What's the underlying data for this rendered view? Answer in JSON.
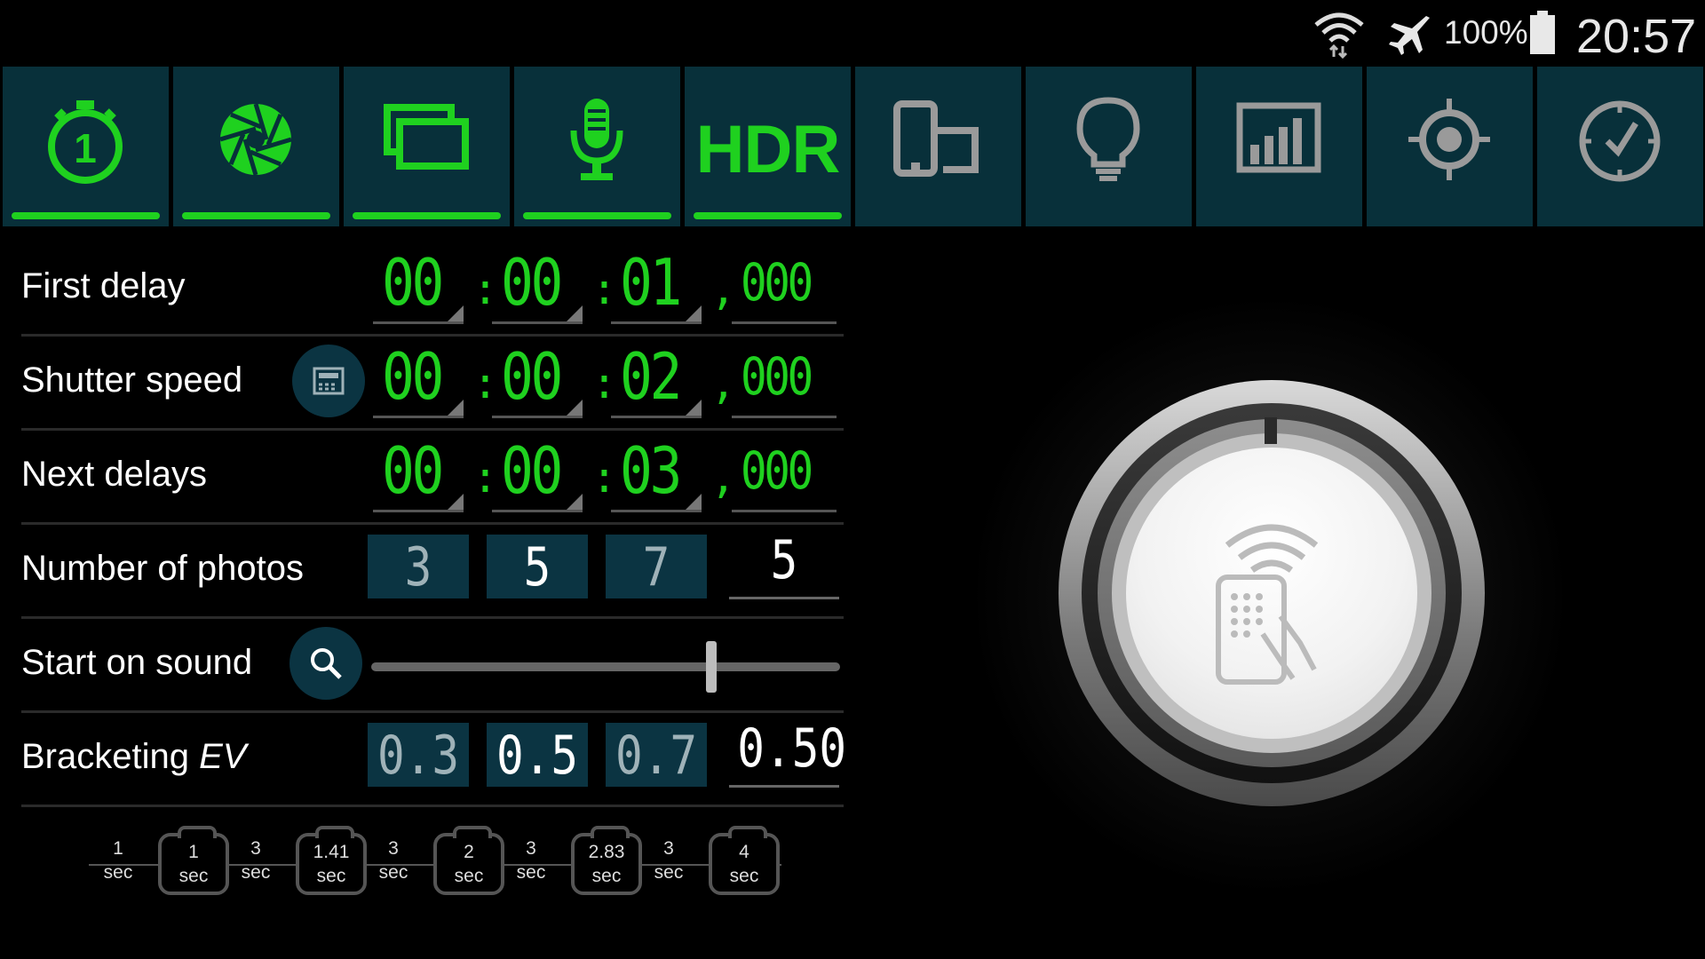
{
  "status_bar": {
    "battery": "100%",
    "time": "20:57"
  },
  "tabs": [
    {
      "name": "timer",
      "active": true
    },
    {
      "name": "shutter",
      "active": true
    },
    {
      "name": "frames",
      "active": true
    },
    {
      "name": "microphone",
      "active": true
    },
    {
      "name": "hdr",
      "label": "HDR",
      "active": true
    },
    {
      "name": "device",
      "active": false
    },
    {
      "name": "bulb",
      "active": false
    },
    {
      "name": "chart",
      "active": false
    },
    {
      "name": "target",
      "active": false
    },
    {
      "name": "clock-check",
      "active": false
    }
  ],
  "rows": {
    "first_delay": {
      "label": "First delay",
      "h": "00",
      "m": "00",
      "s": "01",
      "ms": "000"
    },
    "shutter_speed": {
      "label": "Shutter speed",
      "h": "00",
      "m": "00",
      "s": "02",
      "ms": "000"
    },
    "next_delays": {
      "label": "Next delays",
      "h": "00",
      "m": "00",
      "s": "03",
      "ms": "000"
    },
    "number_of_photos": {
      "label": "Number of photos",
      "options": [
        "3",
        "5",
        "7"
      ],
      "selected": "5",
      "value": "5"
    },
    "start_on_sound": {
      "label": "Start on sound",
      "level": 0.73
    },
    "bracketing": {
      "label": "Bracketing",
      "label_em": "EV",
      "options": [
        "0.3",
        "0.5",
        "0.7"
      ],
      "selected": "0.5",
      "value": "0.50"
    }
  },
  "timeline": [
    {
      "value": "1",
      "unit": "sec",
      "shot": false
    },
    {
      "value": "1",
      "unit": "sec",
      "shot": true
    },
    {
      "value": "3",
      "unit": "sec",
      "shot": false
    },
    {
      "value": "1.41",
      "unit": "sec",
      "shot": true
    },
    {
      "value": "3",
      "unit": "sec",
      "shot": false
    },
    {
      "value": "2",
      "unit": "sec",
      "shot": true
    },
    {
      "value": "3",
      "unit": "sec",
      "shot": false
    },
    {
      "value": "2.83",
      "unit": "sec",
      "shot": true
    },
    {
      "value": "3",
      "unit": "sec",
      "shot": false
    },
    {
      "value": "4",
      "unit": "sec",
      "shot": true
    }
  ],
  "colors": {
    "accent": "#1fd11f",
    "tab_bg": "#08303a",
    "inactive_icon": "#9a9a9a"
  }
}
